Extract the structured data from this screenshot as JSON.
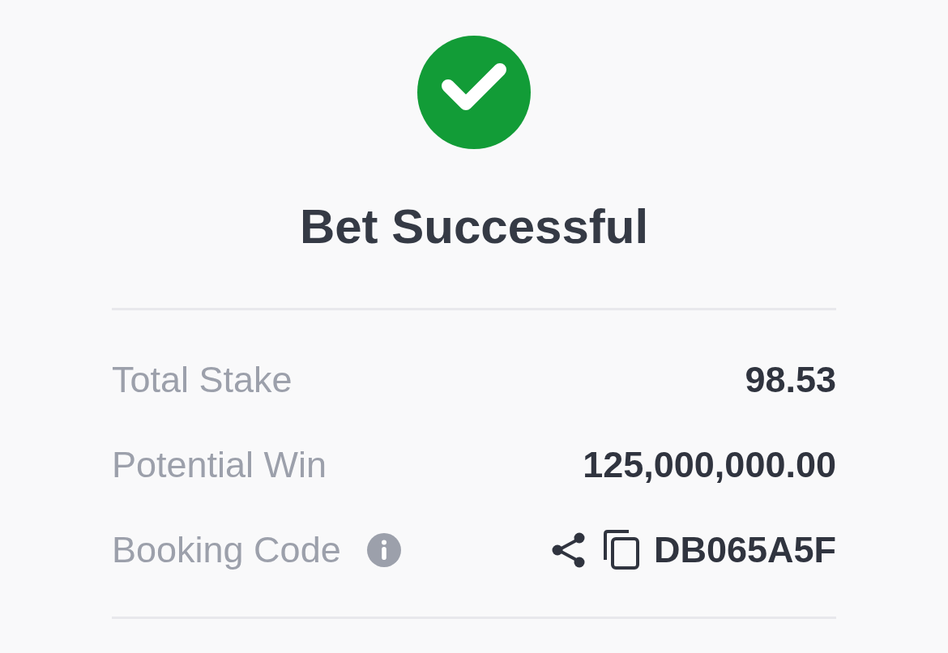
{
  "status": {
    "title": "Bet Successful"
  },
  "details": [
    {
      "kind": "amount",
      "label": "Total Stake",
      "value": "98.53"
    },
    {
      "kind": "amount",
      "label": "Potential Win",
      "value": "125,000,000.00"
    },
    {
      "kind": "code",
      "label": "Booking Code",
      "value": "DB065A5F"
    }
  ]
}
